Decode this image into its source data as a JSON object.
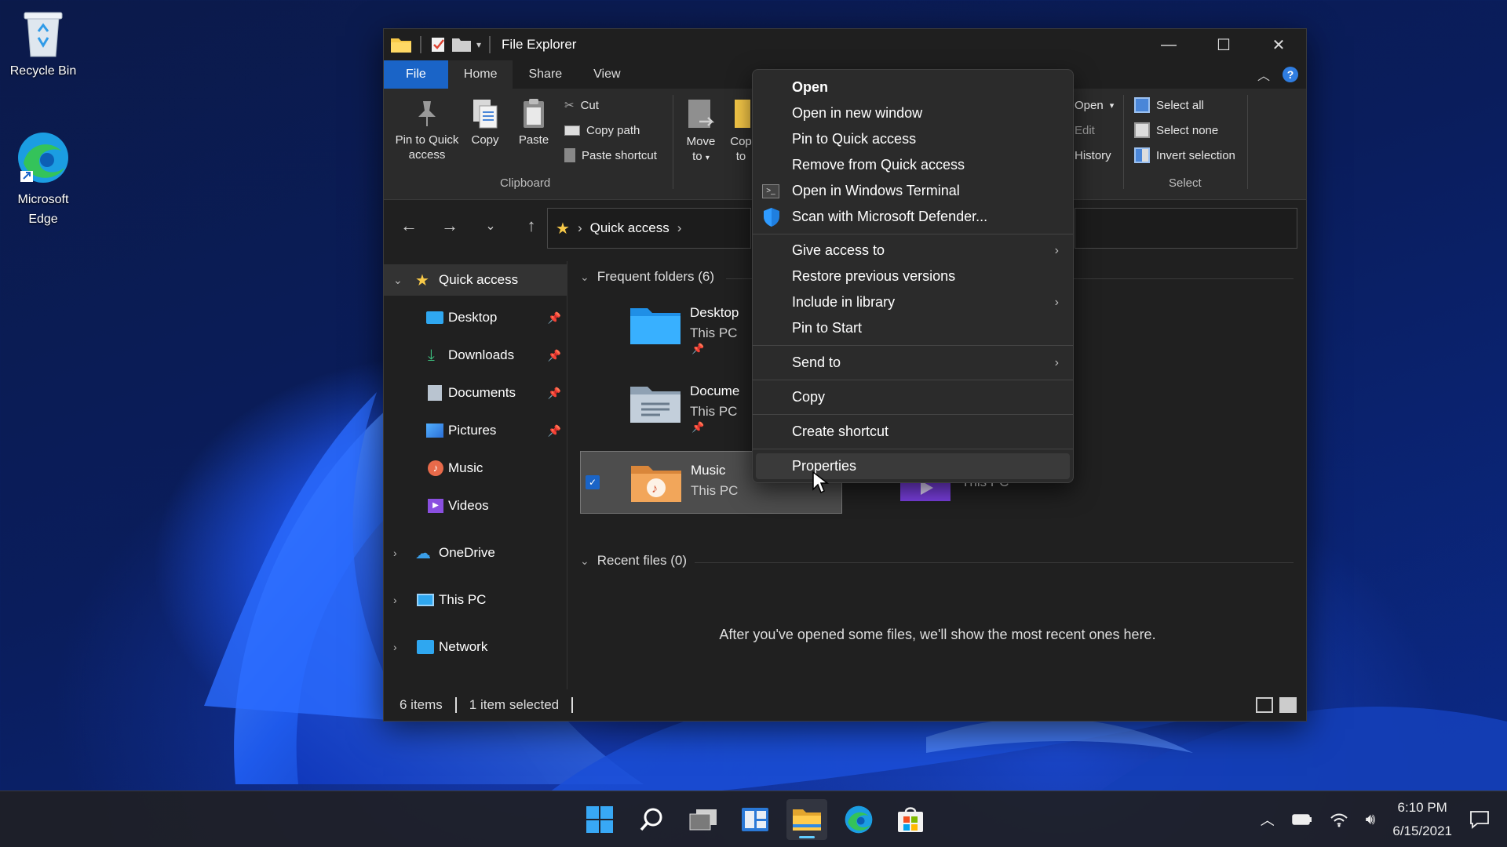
{
  "desktop": {
    "icons": [
      {
        "label": "Recycle Bin"
      },
      {
        "label": "Microsoft\nEdge",
        "label_line1": "Microsoft",
        "label_line2": "Edge"
      }
    ]
  },
  "window": {
    "title": "File Explorer",
    "tabs": {
      "file": "File",
      "home": "Home",
      "share": "Share",
      "view": "View"
    },
    "ribbon": {
      "pin_line1": "Pin to Quick",
      "pin_line2": "access",
      "copy": "Copy",
      "paste": "Paste",
      "cut": "Cut",
      "copy_path": "Copy path",
      "paste_shortcut": "Paste shortcut",
      "clipboard_group": "Clipboard",
      "move_line1": "Move",
      "move_line2": "to",
      "copyto_line1": "Cop",
      "copyto_line2": "to",
      "open": "Open",
      "edit": "Edit",
      "history": "History",
      "select_all": "Select all",
      "select_none": "Select none",
      "invert_selection": "Invert selection",
      "select_group": "Select"
    },
    "address": {
      "location": "Quick access"
    },
    "nav": {
      "quick_access": "Quick access",
      "items": [
        "Desktop",
        "Downloads",
        "Documents",
        "Pictures",
        "Music",
        "Videos"
      ],
      "onedrive": "OneDrive",
      "this_pc": "This PC",
      "network": "Network"
    },
    "content": {
      "frequent_header": "Frequent folders (6)",
      "folders": [
        {
          "name": "Desktop",
          "location": "This PC"
        },
        {
          "name": "Docume",
          "location": "This PC"
        },
        {
          "name": "Music",
          "location": "This PC"
        },
        {
          "name": "",
          "location": "This PC"
        }
      ],
      "recent_header": "Recent files (0)",
      "empty_message": "After you've opened some files, we'll show the most recent ones here."
    },
    "status": {
      "items": "6 items",
      "selected": "1 item selected"
    }
  },
  "context_menu": {
    "items": [
      "Open",
      "Open in new window",
      "Pin to Quick access",
      "Remove from Quick access",
      "Open in Windows Terminal",
      "Scan with Microsoft Defender...",
      "Give access to",
      "Restore previous versions",
      "Include in library",
      "Pin to Start",
      "Send to",
      "Copy",
      "Create shortcut",
      "Properties"
    ]
  },
  "taskbar": {
    "time": "6:10 PM",
    "date": "6/15/2021"
  },
  "colors": {
    "accent": "#1a64c7",
    "folder_yellow": "#f7c948",
    "window_bg": "#202020",
    "menu_bg": "#2b2b2b"
  }
}
